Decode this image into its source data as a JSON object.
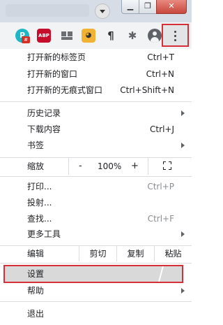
{
  "window": {
    "minimize_glyph": "▁",
    "maximize_glyph": "❐",
    "close_glyph": "✕"
  },
  "extensions": {
    "profile_letter": "P",
    "profile_badge": "#",
    "abp_label": "ABP",
    "paragraph_glyph": "¶",
    "puzzle_glyph": "✱"
  },
  "menu": {
    "group1": [
      {
        "label": "打开新的标签页",
        "shortcut": "Ctrl+T"
      },
      {
        "label": "打开新的窗口",
        "shortcut": "Ctrl+N"
      },
      {
        "label": "打开新的无痕式窗口",
        "shortcut": "Ctrl+Shift+N"
      }
    ],
    "group2": [
      {
        "label": "历史记录",
        "submenu": true
      },
      {
        "label": "下载内容",
        "shortcut": "Ctrl+J"
      },
      {
        "label": "书签",
        "submenu": true
      }
    ],
    "zoom": {
      "label": "缩放",
      "minus": "-",
      "value": "100%",
      "plus": "+"
    },
    "group3": [
      {
        "label": "打印...",
        "shortcut": "Ctrl+P"
      },
      {
        "label": "投射..."
      },
      {
        "label": "查找...",
        "shortcut": "Ctrl+F"
      },
      {
        "label": "更多工具",
        "submenu": true
      }
    ],
    "edit": {
      "label": "编辑",
      "cut": "剪切",
      "copy": "复制",
      "paste": "粘贴"
    },
    "settings": {
      "label": "设置"
    },
    "help": {
      "label": "帮助",
      "submenu": true
    },
    "exit": {
      "label": "退出"
    }
  },
  "colors": {
    "highlight_border": "#d62f3a",
    "settings_bg": "#d9d9d9"
  }
}
